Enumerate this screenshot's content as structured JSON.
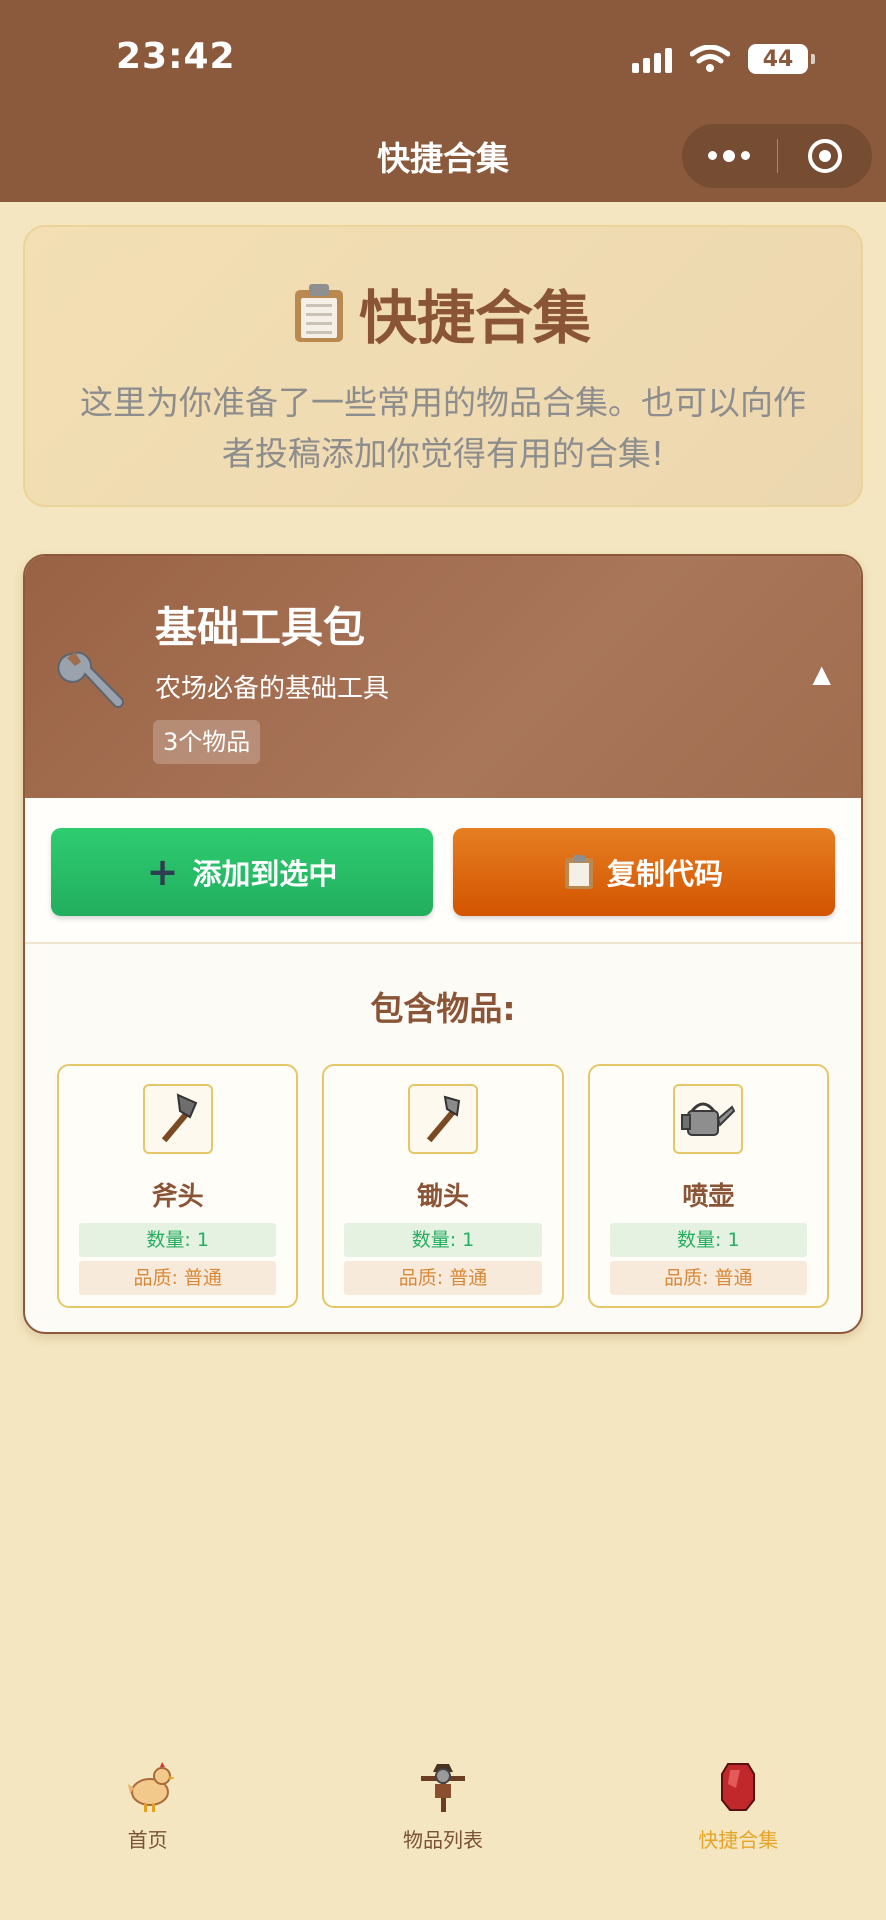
{
  "status_bar": {
    "time": "23:42",
    "battery": "44"
  },
  "nav": {
    "title": "快捷合集"
  },
  "intro": {
    "title": "快捷合集",
    "description": "这里为你准备了一些常用的物品合集。也可以向作者投稿添加你觉得有用的合集!"
  },
  "collection": {
    "name": "基础工具包",
    "description": "农场必备的基础工具",
    "count": "3个物品",
    "collapse_icon": "▲",
    "add_label": "添加到选中",
    "copy_label": "复制代码",
    "contents_title": "包含物品:",
    "items": [
      {
        "name": "斧头",
        "qty": "数量: 1",
        "quality": "品质: 普通",
        "icon": "axe-icon"
      },
      {
        "name": "锄头",
        "qty": "数量: 1",
        "quality": "品质: 普通",
        "icon": "hoe-icon"
      },
      {
        "name": "喷壶",
        "qty": "数量: 1",
        "quality": "品质: 普通",
        "icon": "watering-can-icon"
      }
    ]
  },
  "tabbar": {
    "items": [
      {
        "label": "首页",
        "icon": "chicken-icon"
      },
      {
        "label": "物品列表",
        "icon": "scarecrow-icon"
      },
      {
        "label": "快捷合集",
        "icon": "red-gem-icon",
        "active": true
      }
    ]
  },
  "colors": {
    "primary": "#8b5a3c",
    "background": "#f4e6c0",
    "green": "#2ecc71",
    "orange": "#e67e22",
    "active_tab": "#e6a526"
  }
}
